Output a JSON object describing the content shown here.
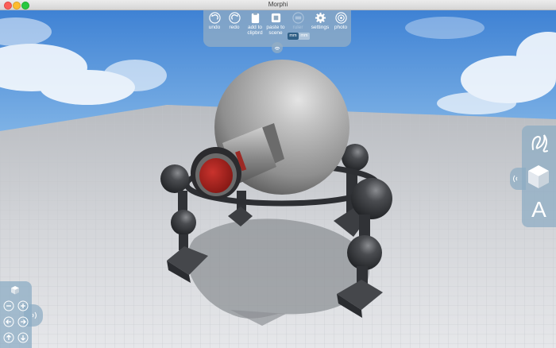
{
  "window": {
    "title": "Morphi"
  },
  "toolbar": {
    "undo_label": "undo",
    "redo_label": "redo",
    "clipboard_label": "add to\nclipbrd",
    "paste_label": "paste to\nscene",
    "ruler_label": "ruler",
    "settings_label": "settings",
    "photo_label": "photo",
    "unit_active": "mm",
    "unit_other": "mm"
  },
  "right_tools": {
    "text_label": "A"
  },
  "colors": {
    "sky": "#4f8fd8",
    "floor": "#d5d8dc",
    "panel": "#8cacc4",
    "body_gray": "#9c9c9c",
    "dark_part": "#3c3e42",
    "lens_red": "#b3241f"
  }
}
